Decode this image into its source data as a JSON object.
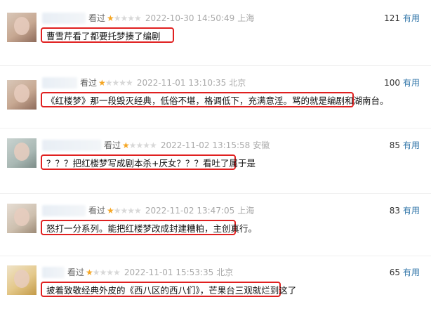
{
  "reviews": [
    {
      "watched": "看过",
      "rating": 1,
      "star_glyphs": {
        "on": "★",
        "off": "★★★★"
      },
      "time": "2022-10-30 14:50:49",
      "location": "上海",
      "votes": "121",
      "useful_label": "有用",
      "comment": "曹雪芹看了都要托梦揍了编剧"
    },
    {
      "watched": "看过",
      "rating": 1,
      "star_glyphs": {
        "on": "★",
        "off": "★★★★"
      },
      "time": "2022-11-01 13:10:35",
      "location": "北京",
      "votes": "100",
      "useful_label": "有用",
      "comment": "《红楼梦》那一段毁灭经典，低俗不堪，格调低下，充满意淫。骂的就是编剧和湖南台。"
    },
    {
      "watched": "看过",
      "rating": 1,
      "star_glyphs": {
        "on": "★",
        "off": "★★★★"
      },
      "time": "2022-11-02 13:15:58",
      "location": "安徽",
      "votes": "85",
      "useful_label": "有用",
      "comment": "？？？把红楼梦写成剧本杀+厌女？？？看吐了属于是"
    },
    {
      "watched": "看过",
      "rating": 1,
      "star_glyphs": {
        "on": "★",
        "off": "★★★★"
      },
      "time": "2022-11-02 13:47:05",
      "location": "上海",
      "votes": "83",
      "useful_label": "有用",
      "comment": "怒打一分系列。能把红楼梦改成封建糟粕，主创真行。"
    },
    {
      "watched": "看过",
      "rating": 1,
      "star_glyphs": {
        "on": "★",
        "off": "★★★★"
      },
      "time": "2022-11-01 15:53:35",
      "location": "北京",
      "votes": "65",
      "useful_label": "有用",
      "comment": "披着致敬经典外皮的《西八区的西八们》，芒果台三观就烂到这了"
    }
  ]
}
